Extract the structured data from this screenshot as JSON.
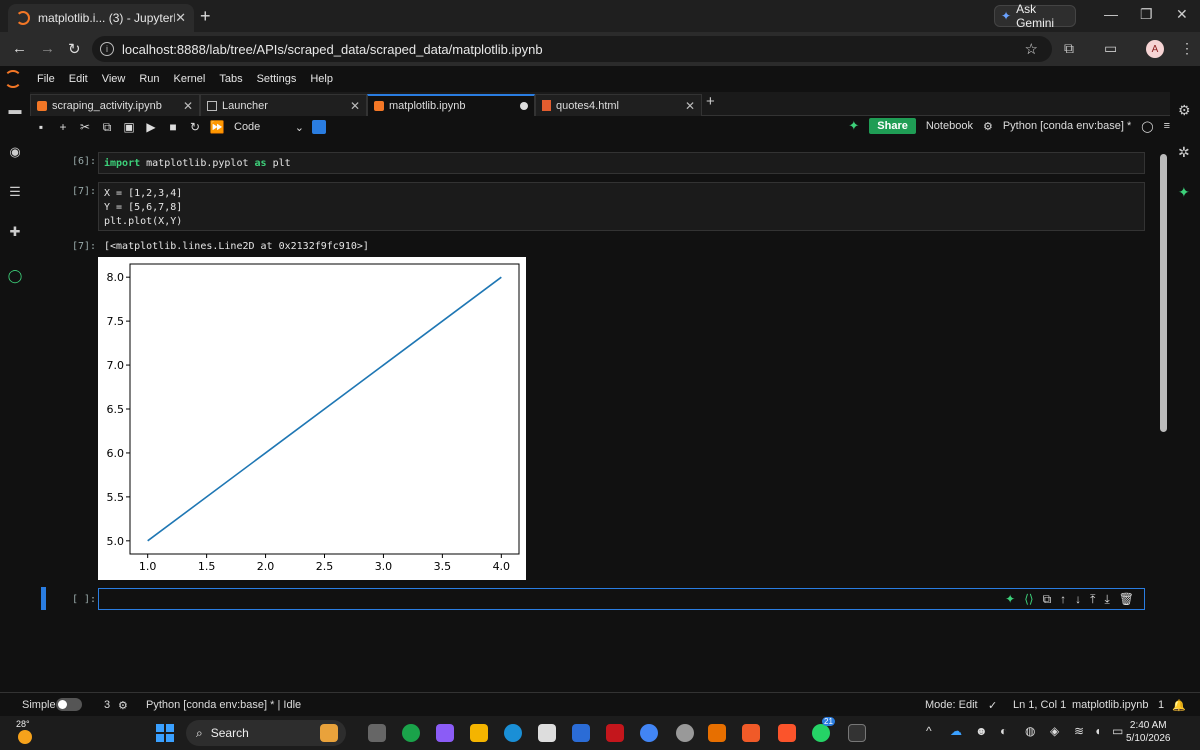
{
  "browser": {
    "tab_title": "matplotlib.i... (3) - JupyterLab",
    "ask_gemini": "Ask Gemini",
    "url": "localhost:8888/lab/tree/APIs/scraped_data/scraped_data/matplotlib.ipynb",
    "profile_initial": "A"
  },
  "menu": [
    "File",
    "Edit",
    "View",
    "Run",
    "Kernel",
    "Tabs",
    "Settings",
    "Help"
  ],
  "doc_tabs": [
    {
      "label": "scraping_activity.ipynb",
      "icon": "notebook-icon"
    },
    {
      "label": "Launcher",
      "icon": "launcher-icon"
    },
    {
      "label": "matplotlib.ipynb",
      "icon": "notebook-icon",
      "active": true
    },
    {
      "label": "quotes4.html",
      "icon": "html-icon"
    }
  ],
  "toolbar": {
    "cell_type": "Code",
    "share": "Share",
    "notebook_label": "Notebook",
    "kernel": "Python [conda env:base] *"
  },
  "cells": {
    "c1_prompt": "[6]:",
    "c1_code": [
      "import",
      " matplotlib.pyplot ",
      "as",
      " plt"
    ],
    "c2_prompt": "[7]:",
    "c2_line1": "X = [1,2,3,4]",
    "c2_line2": "Y = [5,6,7,8]",
    "c2_line3": "plt.plot(X,Y)",
    "out_prompt": "[7]:",
    "out_text": "[<matplotlib.lines.Line2D at 0x2132f9fc910>]",
    "empty_prompt": "[ ]:"
  },
  "chart_data": {
    "type": "line",
    "x": [
      1,
      2,
      3,
      4
    ],
    "series": [
      {
        "values": [
          5,
          6,
          7,
          8
        ],
        "color": "#1f77b4"
      }
    ],
    "xlim": [
      0.85,
      4.15
    ],
    "ylim": [
      4.85,
      8.15
    ],
    "xticks": [
      "1.0",
      "1.5",
      "2.0",
      "2.5",
      "3.0",
      "3.5",
      "4.0"
    ],
    "yticks": [
      "5.0",
      "5.5",
      "6.0",
      "6.5",
      "7.0",
      "7.5",
      "8.0"
    ],
    "title": "",
    "xlabel": "",
    "ylabel": "",
    "grid": false
  },
  "status": {
    "mode_simple": "Simple",
    "count": "3",
    "kernel_status": "Python [conda env:base] * | Idle",
    "mode": "Mode: Edit",
    "position": "Ln 1, Col 1",
    "filename": "matplotlib.ipynb",
    "notif_count": "1"
  },
  "taskbar": {
    "temperature": "28°",
    "search": "Search",
    "whatsapp_badge": "21",
    "time": "2:40 AM",
    "date": "5/10/2026"
  }
}
